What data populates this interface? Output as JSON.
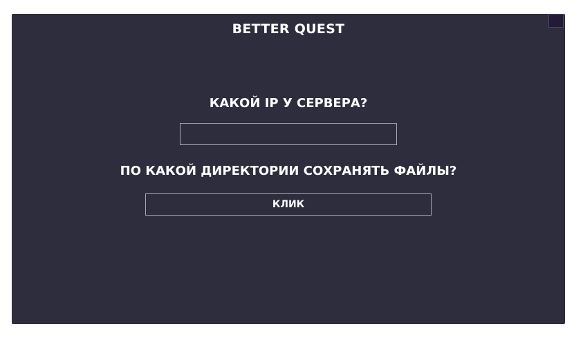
{
  "app": {
    "title": "BETTER QUEST",
    "close_icon": "close-icon"
  },
  "form": {
    "ip_question": "КАКОЙ IP У СЕРВЕРА?",
    "ip_value": "",
    "ip_placeholder": "",
    "dir_question": "ПО КАКОЙ ДИРЕКТОРИИ СОХРАНЯТЬ ФАЙЛЫ?",
    "dir_button_label": "КЛИК"
  },
  "colors": {
    "window_bg": "#2e2d3d",
    "text": "#ffffff",
    "field_border": "#a7a6b0",
    "close_button": "#241a38"
  }
}
